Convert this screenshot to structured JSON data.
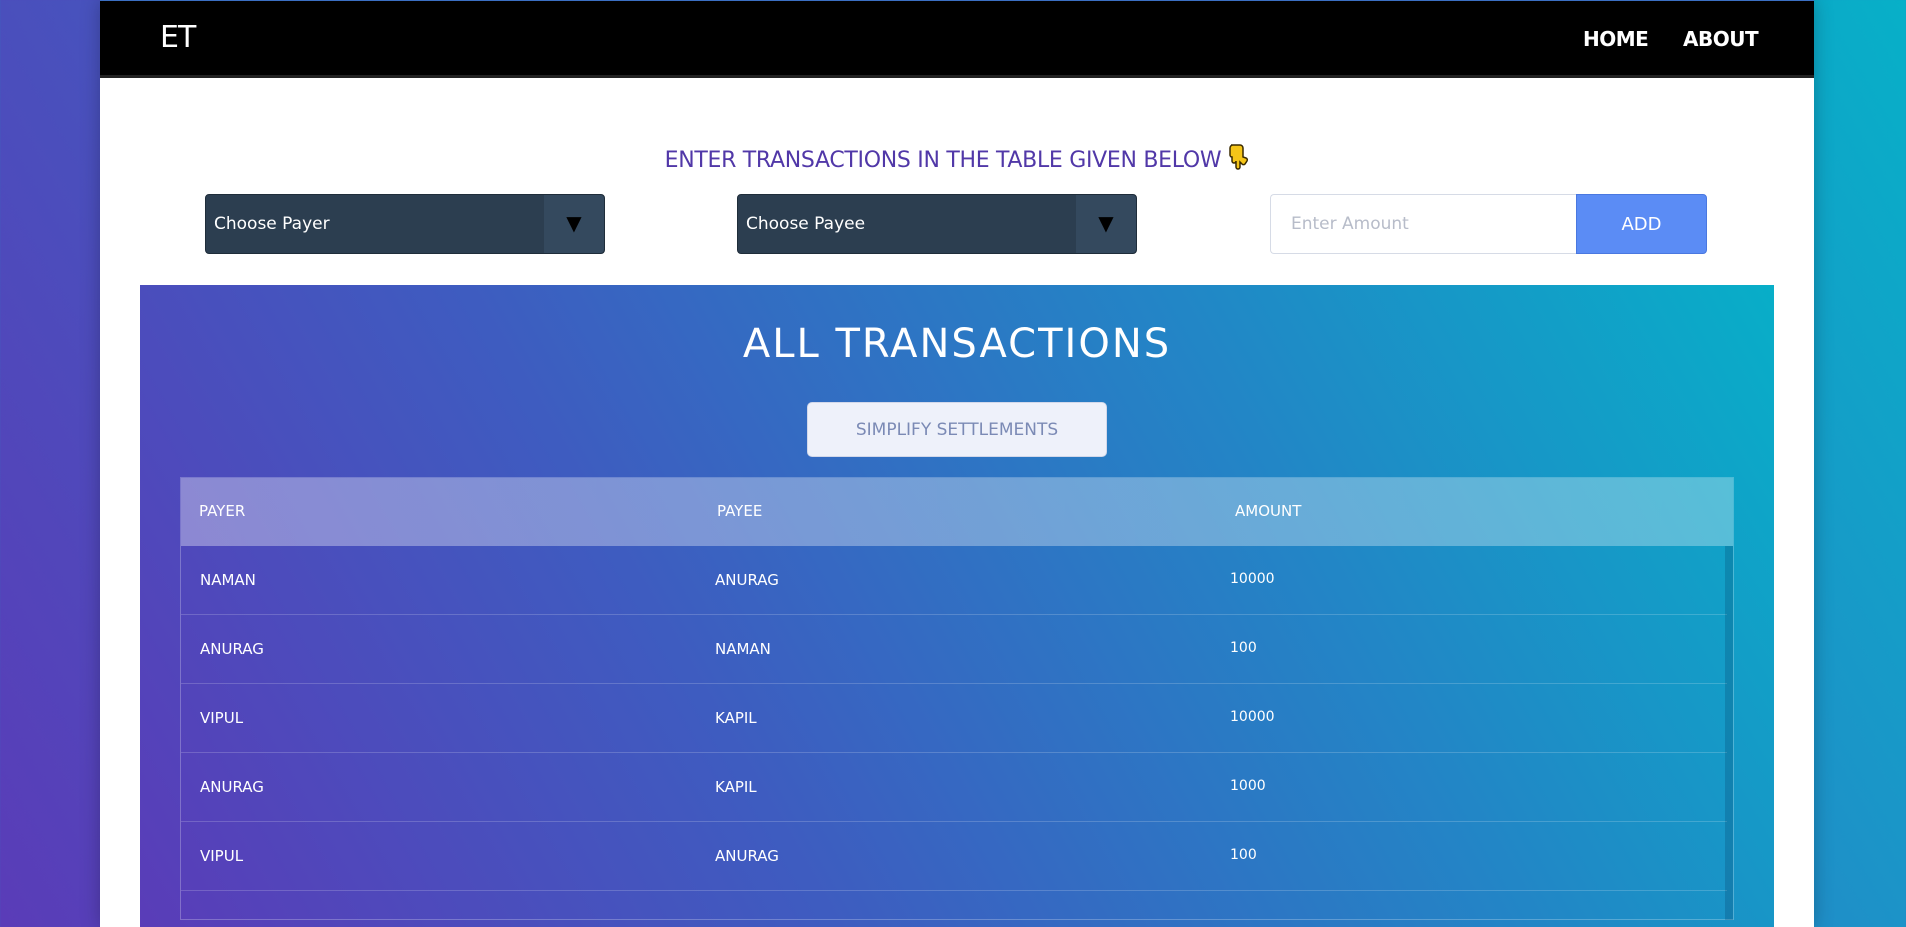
{
  "navbar": {
    "brand": "ET",
    "links": [
      "HOME",
      "ABOUT"
    ]
  },
  "form": {
    "instruction": "ENTER TRANSACTIONS IN THE TABLE GIVEN BELOW",
    "instruction_icon": "pointing-hand-icon",
    "payer_select": {
      "selected": "Choose Payer",
      "arrow": "▼"
    },
    "payee_select": {
      "selected": "Choose Payee",
      "arrow": "▼"
    },
    "amount": {
      "placeholder": "Enter Amount",
      "value": ""
    },
    "add_label": "ADD"
  },
  "transactions": {
    "title": "ALL TRANSACTIONS",
    "simplify_label": "SIMPLIFY SETTLEMENTS",
    "columns": [
      "PAYER",
      "PAYEE",
      "AMOUNT"
    ],
    "rows": [
      {
        "payer": "NAMAN",
        "payee": "ANURAG",
        "amount": "10000"
      },
      {
        "payer": "ANURAG",
        "payee": "NAMAN",
        "amount": "100"
      },
      {
        "payer": "VIPUL",
        "payee": "KAPIL",
        "amount": "10000"
      },
      {
        "payer": "ANURAG",
        "payee": "KAPIL",
        "amount": "1000"
      },
      {
        "payer": "VIPUL",
        "payee": "ANURAG",
        "amount": "100"
      }
    ]
  },
  "colors": {
    "navbar_bg": "#000000",
    "instruction_text": "#5138a8",
    "select_bg": "#2c3e50",
    "add_button_bg": "#5b8cf5",
    "gradient_start": "#5a3cb8",
    "gradient_end": "#08aec8"
  }
}
